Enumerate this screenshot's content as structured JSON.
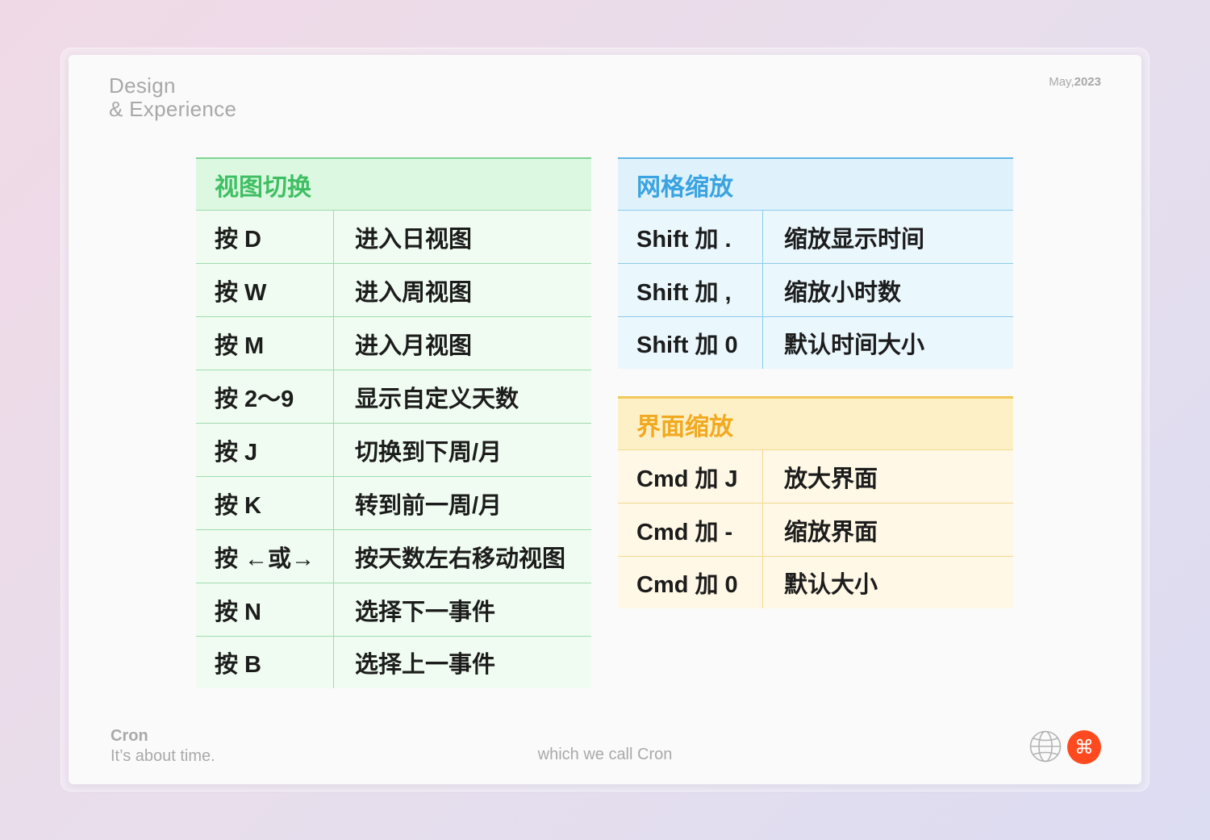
{
  "header": {
    "brand_line1": "Design",
    "brand_line2": "& Experience",
    "date_month": "May,",
    "date_year": "2023"
  },
  "tables": {
    "view_switch": {
      "title": "视图切换",
      "rows": [
        {
          "key": "按 D",
          "action": "进入日视图"
        },
        {
          "key": "按 W",
          "action": "进入周视图"
        },
        {
          "key": "按 M",
          "action": "进入月视图"
        },
        {
          "key": "按 2～9",
          "action": "显示自定义天数"
        },
        {
          "key": "按 J",
          "action": "切换到下周/月"
        },
        {
          "key": "按 K",
          "action": "转到前一周/月"
        },
        {
          "key": "按 ←或→",
          "action": "按天数左右移动视图"
        },
        {
          "key": "按 N",
          "action": "选择下一事件"
        },
        {
          "key": "按 B",
          "action": "选择上一事件"
        }
      ]
    },
    "grid_zoom": {
      "title": "网格缩放",
      "rows": [
        {
          "key": "Shift 加 .",
          "action": "缩放显示时间"
        },
        {
          "key": "Shift 加 ,",
          "action": "缩放小时数"
        },
        {
          "key": "Shift 加 0",
          "action": "默认时间大小"
        }
      ]
    },
    "ui_zoom": {
      "title": "界面缩放",
      "rows": [
        {
          "key": "Cmd 加 J",
          "action": "放大界面"
        },
        {
          "key": "Cmd 加 -",
          "action": "缩放界面"
        },
        {
          "key": "Cmd 加 0",
          "action": "默认大小"
        }
      ]
    }
  },
  "footer": {
    "app_name": "Cron",
    "tagline": "It’s about time.",
    "center_text": "which we call Cron",
    "globe_icon": "globe-icon",
    "cmd_icon": "command-icon",
    "cmd_glyph": "⌘",
    "accent_color": "#ff4a1f"
  }
}
